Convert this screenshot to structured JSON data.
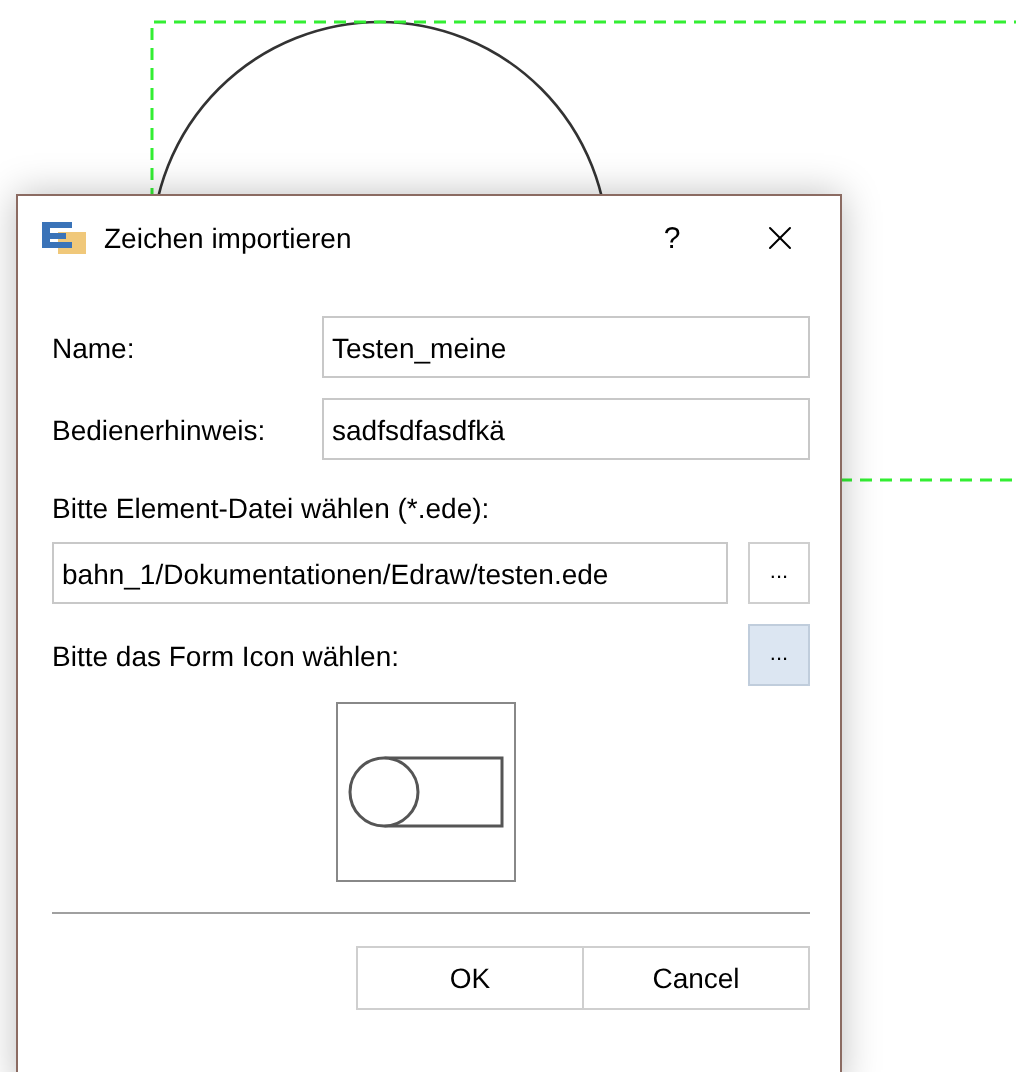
{
  "dialog": {
    "title": "Zeichen importieren",
    "help": "?"
  },
  "fields": [
    {
      "label": "Name:",
      "value": "Testen_meine"
    },
    {
      "label": "Bedienerhinweis:",
      "value": "sadfsdfasdfkä"
    }
  ],
  "file": {
    "label": "Bitte Element-Datei wählen (*.ede):",
    "value": "bahn_1/Dokumentationen/Edraw/testen.ede",
    "button": {
      "label": "...",
      "highlighted": false
    }
  },
  "icon": {
    "label": "Bitte das Form Icon wählen:",
    "button": {
      "label": "...",
      "highlighted": true
    }
  },
  "buttons": [
    "OK",
    "Cancel"
  ]
}
